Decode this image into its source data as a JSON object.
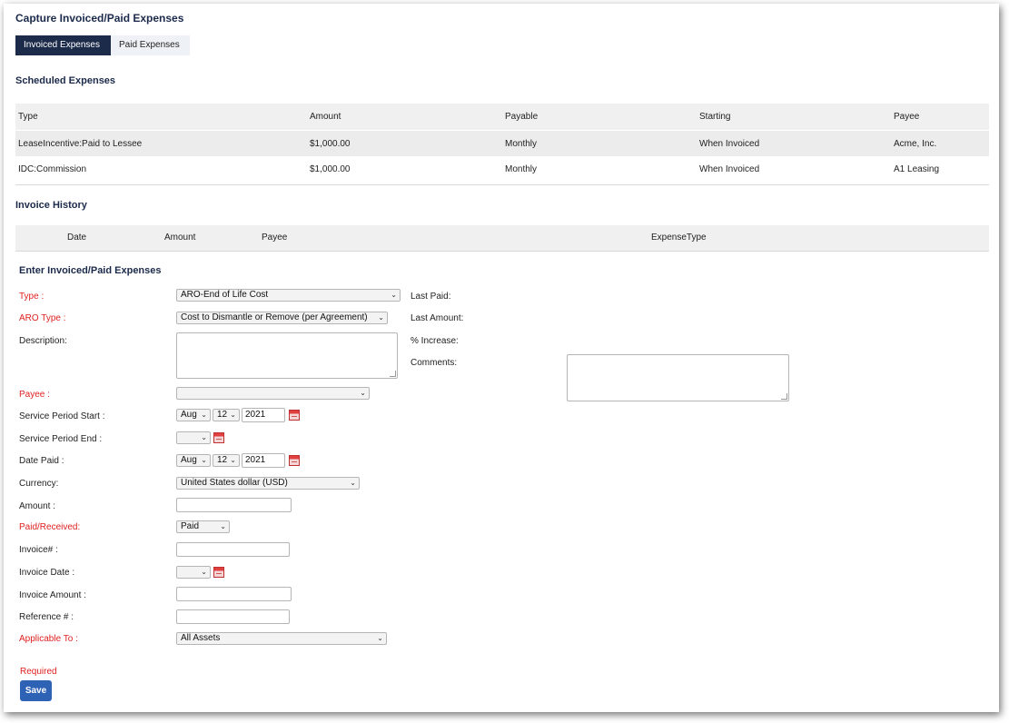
{
  "page": {
    "title": "Capture Invoiced/Paid Expenses"
  },
  "tabs": [
    {
      "label": "Invoiced Expenses",
      "active": true
    },
    {
      "label": "Paid Expenses",
      "active": false
    }
  ],
  "scheduled": {
    "title": "Scheduled Expenses",
    "columns": [
      "Type",
      "Amount",
      "Payable",
      "Starting",
      "Payee"
    ],
    "rows": [
      [
        "LeaseIncentive:Paid to Lessee",
        "$1,000.00",
        "Monthly",
        "When Invoiced",
        "Acme, Inc."
      ],
      [
        "IDC:Commission",
        "$1,000.00",
        "Monthly",
        "When Invoiced",
        "A1 Leasing"
      ]
    ]
  },
  "history": {
    "title": "Invoice History",
    "columns": [
      "Date",
      "Amount",
      "Payee",
      "ExpenseType"
    ]
  },
  "form": {
    "title": "Enter Invoiced/Paid Expenses",
    "type_label": "Type :",
    "type_value": "ARO-End of Life Cost",
    "aro_type_label": "ARO Type :",
    "aro_type_value": "Cost to Dismantle or Remove (per Agreement)",
    "description_label": "Description:",
    "payee_label": "Payee :",
    "payee_value": "",
    "service_start_label": "Service Period Start :",
    "service_start": {
      "month": "Aug",
      "day": "12",
      "year": "2021"
    },
    "service_end_label": "Service Period End :",
    "service_end_value": "",
    "date_paid_label": "Date Paid :",
    "date_paid": {
      "month": "Aug",
      "day": "12",
      "year": "2021"
    },
    "currency_label": "Currency:",
    "currency_value": "United States dollar (USD)",
    "amount_label": "Amount :",
    "amount_value": "",
    "paid_received_label": "Paid/Received:",
    "paid_received_value": "Paid",
    "invoice_no_label": "Invoice# :",
    "invoice_no_value": "",
    "invoice_date_label": "Invoice Date :",
    "invoice_date_value": "",
    "invoice_amount_label": "Invoice Amount :",
    "invoice_amount_value": "",
    "reference_label": "Reference # :",
    "reference_value": "",
    "applicable_to_label": "Applicable To :",
    "applicable_to_value": "All Assets",
    "last_paid_label": "Last Paid:",
    "last_amount_label": "Last Amount:",
    "increase_label": "% Increase:",
    "comments_label": "Comments:",
    "required_text": "Required",
    "save_label": "Save"
  },
  "colors": {
    "accent": "#1c2b4a",
    "required": "#e02020",
    "button": "#2e62b5"
  },
  "icons": {
    "dropdown": "chevron-down-icon",
    "calendar": "calendar-icon"
  }
}
